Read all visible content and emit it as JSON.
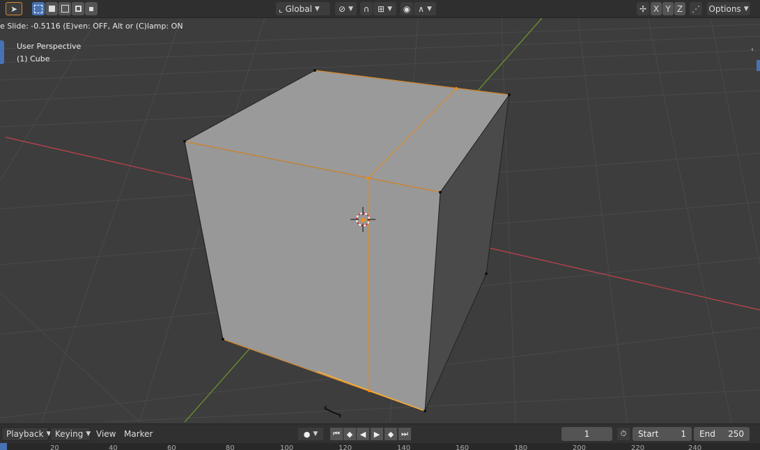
{
  "toolbar": {
    "orientation": "Global",
    "axis_x": "X",
    "axis_y": "Y",
    "axis_z": "Z",
    "options": "Options"
  },
  "status": {
    "text": "e Slide: -0.5116 (E)ven: OFF, Alt or (C)lamp: ON"
  },
  "viewport": {
    "view_name": "User Perspective",
    "object_name": "(1) Cube"
  },
  "timeline": {
    "playback": "Playback",
    "keying": "Keying",
    "view": "View",
    "marker": "Marker",
    "current_frame": "1",
    "start_label": "Start",
    "start_value": "1",
    "end_label": "End",
    "end_value": "250",
    "ruler": [
      "20",
      "40",
      "60",
      "80",
      "100",
      "120",
      "140",
      "160",
      "180",
      "200",
      "220",
      "240"
    ]
  },
  "colors": {
    "accent": "#4772b3",
    "selection": "#ff8c00",
    "x_axis": "#c4424d",
    "y_axis": "#6f9a2a"
  }
}
